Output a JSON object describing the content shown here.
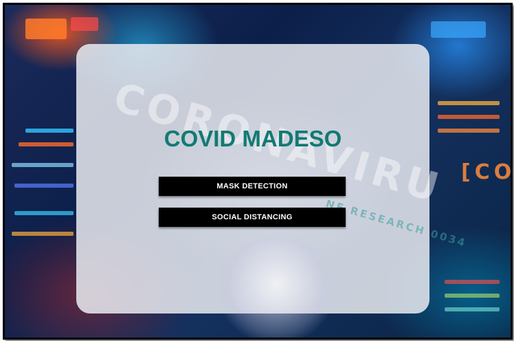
{
  "app": {
    "title": "COVID MADESO"
  },
  "background": {
    "words": [
      "CORONAVIRU",
      "[CO",
      "NE RESEARCH 0034"
    ]
  },
  "buttons": {
    "mask_detection": "MASK DETECTION",
    "social_distancing": "SOCIAL DISTANCING"
  },
  "colors": {
    "title": "#127a73",
    "button_bg": "#000000",
    "button_text": "#ffffff",
    "panel": "#e8eaf0"
  }
}
